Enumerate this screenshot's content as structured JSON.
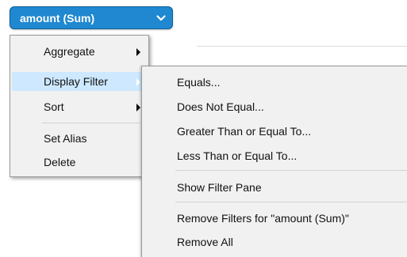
{
  "field_pill": {
    "label": "amount (Sum)",
    "icon": "chevron-down-icon",
    "color": "#1f88d0"
  },
  "context_menu": {
    "items": [
      {
        "label": "Aggregate",
        "has_submenu": true
      },
      {
        "label": "Display Filter",
        "has_submenu": true,
        "highlighted": true
      },
      {
        "label": "Sort",
        "has_submenu": true
      },
      {
        "label": "Set Alias",
        "has_submenu": false
      },
      {
        "label": "Delete",
        "has_submenu": false
      }
    ]
  },
  "display_filter_submenu": {
    "items": [
      {
        "label": "Equals..."
      },
      {
        "label": "Does Not Equal..."
      },
      {
        "label": "Greater Than or Equal To..."
      },
      {
        "label": "Less Than or Equal To..."
      },
      {
        "label": "Show Filter Pane"
      },
      {
        "label": "Remove Filters for \"amount (Sum)\""
      },
      {
        "label": "Remove All"
      }
    ]
  },
  "colors": {
    "highlight": "#cde8ff",
    "menu_background": "#f1f1f1"
  }
}
